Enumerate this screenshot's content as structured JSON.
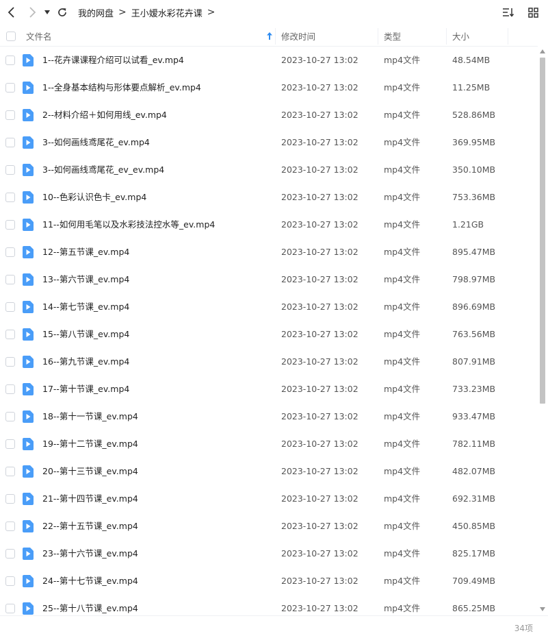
{
  "breadcrumb": {
    "root": "我的网盘",
    "current": "王小嫒水彩花卉课"
  },
  "header": {
    "name": "文件名",
    "time": "修改时间",
    "type": "类型",
    "size": "大小"
  },
  "colors": {
    "file_icon": "#4a9df8",
    "sort_arrow": "#2f8cf0"
  },
  "files": [
    {
      "name": "1--花卉课课程介绍可以试看_ev.mp4",
      "time": "2023-10-27 13:02",
      "type": "mp4文件",
      "size": "48.54MB"
    },
    {
      "name": "1--全身基本结构与形体要点解析_ev.mp4",
      "time": "2023-10-27 13:02",
      "type": "mp4文件",
      "size": "11.25MB"
    },
    {
      "name": "2--材料介绍＋如何用线_ev.mp4",
      "time": "2023-10-27 13:02",
      "type": "mp4文件",
      "size": "528.86MB"
    },
    {
      "name": "3--如何画线鸢尾花_ev.mp4",
      "time": "2023-10-27 13:02",
      "type": "mp4文件",
      "size": "369.95MB"
    },
    {
      "name": "3--如何画线鸢尾花_ev_ev.mp4",
      "time": "2023-10-27 13:02",
      "type": "mp4文件",
      "size": "350.10MB"
    },
    {
      "name": "10--色彩认识色卡_ev.mp4",
      "time": "2023-10-27 13:02",
      "type": "mp4文件",
      "size": "753.36MB"
    },
    {
      "name": "11--如何用毛笔以及水彩技法控水等_ev.mp4",
      "time": "2023-10-27 13:02",
      "type": "mp4文件",
      "size": "1.21GB"
    },
    {
      "name": "12--第五节课_ev.mp4",
      "time": "2023-10-27 13:02",
      "type": "mp4文件",
      "size": "895.47MB"
    },
    {
      "name": "13--第六节课_ev.mp4",
      "time": "2023-10-27 13:02",
      "type": "mp4文件",
      "size": "798.97MB"
    },
    {
      "name": "14--第七节课_ev.mp4",
      "time": "2023-10-27 13:02",
      "type": "mp4文件",
      "size": "896.69MB"
    },
    {
      "name": "15--第八节课_ev.mp4",
      "time": "2023-10-27 13:02",
      "type": "mp4文件",
      "size": "763.56MB"
    },
    {
      "name": "16--第九节课_ev.mp4",
      "time": "2023-10-27 13:02",
      "type": "mp4文件",
      "size": "807.91MB"
    },
    {
      "name": "17--第十节课_ev.mp4",
      "time": "2023-10-27 13:02",
      "type": "mp4文件",
      "size": "733.23MB"
    },
    {
      "name": "18--第十一节课_ev.mp4",
      "time": "2023-10-27 13:02",
      "type": "mp4文件",
      "size": "933.47MB"
    },
    {
      "name": "19--第十二节课_ev.mp4",
      "time": "2023-10-27 13:02",
      "type": "mp4文件",
      "size": "782.11MB"
    },
    {
      "name": "20--第十三节课_ev.mp4",
      "time": "2023-10-27 13:02",
      "type": "mp4文件",
      "size": "482.07MB"
    },
    {
      "name": "21--第十四节课_ev.mp4",
      "time": "2023-10-27 13:02",
      "type": "mp4文件",
      "size": "692.31MB"
    },
    {
      "name": "22--第十五节课_ev.mp4",
      "time": "2023-10-27 13:02",
      "type": "mp4文件",
      "size": "450.85MB"
    },
    {
      "name": "23--第十六节课_ev.mp4",
      "time": "2023-10-27 13:02",
      "type": "mp4文件",
      "size": "825.17MB"
    },
    {
      "name": "24--第十七节课_ev.mp4",
      "time": "2023-10-27 13:02",
      "type": "mp4文件",
      "size": "709.49MB"
    },
    {
      "name": "25--第十八节课_ev.mp4",
      "time": "2023-10-27 13:02",
      "type": "mp4文件",
      "size": "865.25MB"
    }
  ],
  "footer": {
    "count": "34项"
  }
}
